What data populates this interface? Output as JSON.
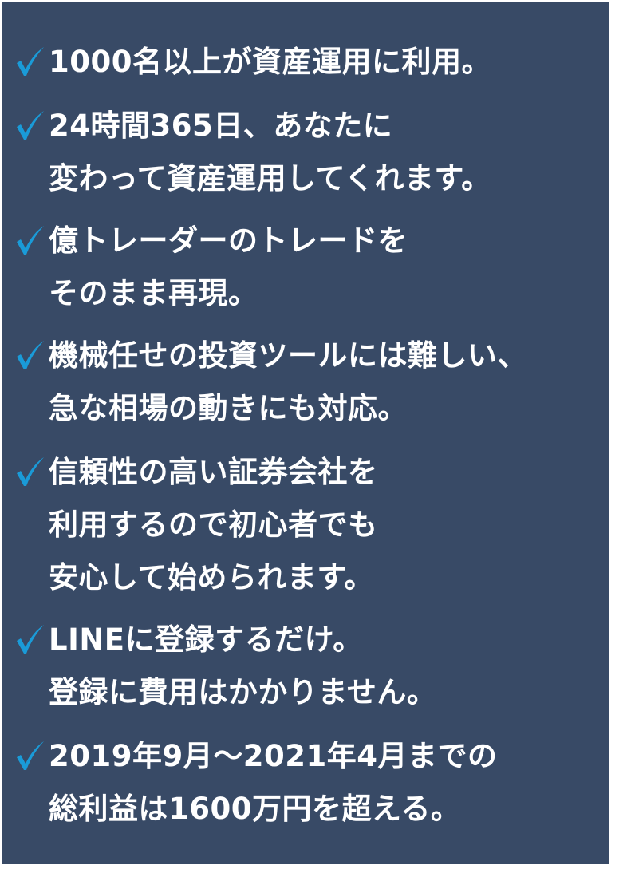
{
  "colors": {
    "background": "#384a66",
    "check": "#1a9bd8",
    "text": "#ffffff"
  },
  "check_icon": "checkmark-icon",
  "items": [
    {
      "lines": [
        "1000名以上が資産運用に利用。"
      ]
    },
    {
      "lines": [
        "24時間365日、あなたに",
        "変わって資産運用してくれます。"
      ]
    },
    {
      "lines": [
        "億トレーダーのトレードを",
        "そのまま再現。"
      ]
    },
    {
      "lines": [
        "機械任せの投資ツールには難しい、",
        "急な相場の動きにも対応。"
      ]
    },
    {
      "lines": [
        "信頼性の高い証券会社を",
        "利用するので初心者でも",
        "安心して始められます。"
      ]
    },
    {
      "lines": [
        "LINEに登録するだけ。",
        "登録に費用はかかりません。"
      ]
    },
    {
      "lines": [
        "2019年9月～2021年4月までの",
        "総利益は1600万円を超える。"
      ]
    }
  ]
}
